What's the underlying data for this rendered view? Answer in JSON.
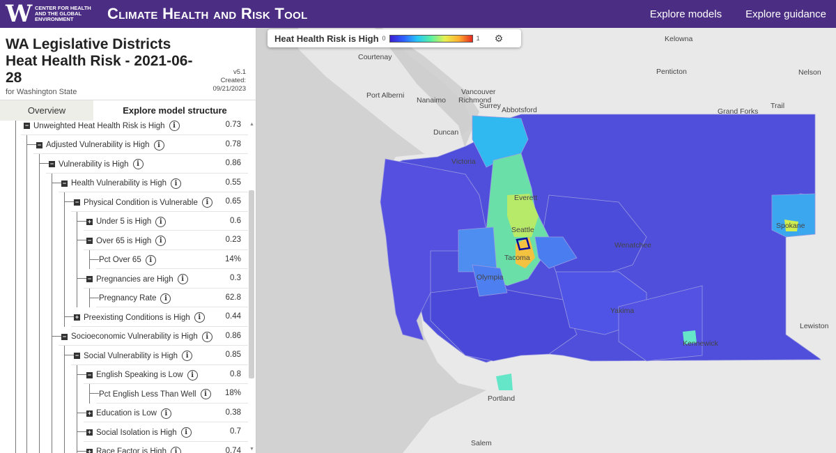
{
  "header": {
    "logo_mark": "W",
    "logo_text": "Center for Health and the Global Environment",
    "app_title": "Climate Health and Risk Tool",
    "nav": [
      "Explore models",
      "Explore guidance"
    ]
  },
  "sidebar": {
    "title": "WA Legislative Districts Heat Health Risk - 2021-06-28",
    "subtitle": "for Washington State",
    "version": "v5.1",
    "created_label": "Created:",
    "created_date": "09/21/2023",
    "tabs": [
      {
        "label": "Overview",
        "active": false
      },
      {
        "label": "Explore model structure",
        "active": true
      }
    ],
    "tree": [
      {
        "label": "Unweighted Heat Health Risk is High",
        "value": "0.73",
        "level": 0,
        "toggle": "minus"
      },
      {
        "label": "Adjusted Vulnerability is High",
        "value": "0.78",
        "level": 1,
        "toggle": "minus"
      },
      {
        "label": "Vulnerability is High",
        "value": "0.86",
        "level": 2,
        "toggle": "minus"
      },
      {
        "label": "Health Vulnerability is High",
        "value": "0.55",
        "level": 3,
        "toggle": "minus"
      },
      {
        "label": "Physical Condition is Vulnerable",
        "value": "0.65",
        "level": 4,
        "toggle": "minus"
      },
      {
        "label": "Under 5 is High",
        "value": "0.6",
        "level": 5,
        "toggle": "plus"
      },
      {
        "label": "Over 65 is High",
        "value": "0.23",
        "level": 5,
        "toggle": "minus"
      },
      {
        "label": "Pct Over 65",
        "value": "14%",
        "level": 6,
        "toggle": "none"
      },
      {
        "label": "Pregnancies are High",
        "value": "0.3",
        "level": 5,
        "toggle": "minus"
      },
      {
        "label": "Pregnancy Rate",
        "value": "62.8",
        "level": 6,
        "toggle": "none"
      },
      {
        "label": "Preexisting Conditions is High",
        "value": "0.44",
        "level": 4,
        "toggle": "plus"
      },
      {
        "label": "Socioeconomic Vulnerability is High",
        "value": "0.86",
        "level": 3,
        "toggle": "minus"
      },
      {
        "label": "Social Vulnerability is High",
        "value": "0.85",
        "level": 4,
        "toggle": "minus"
      },
      {
        "label": "English Speaking is Low",
        "value": "0.8",
        "level": 5,
        "toggle": "minus"
      },
      {
        "label": "Pct English Less Than Well",
        "value": "18%",
        "level": 6,
        "toggle": "none"
      },
      {
        "label": "Education is Low",
        "value": "0.38",
        "level": 5,
        "toggle": "plus"
      },
      {
        "label": "Social Isolation is High",
        "value": "0.7",
        "level": 5,
        "toggle": "plus"
      },
      {
        "label": "Race Factor is High",
        "value": "0.74",
        "level": 5,
        "toggle": "plus"
      }
    ]
  },
  "map": {
    "legend": {
      "title": "Heat Health Risk is High",
      "min": "0",
      "max": "1",
      "settings_icon": "gear-icon"
    },
    "cities": [
      "Kelowna",
      "Courtenay",
      "Penticton",
      "Nelson",
      "Port Alberni",
      "Nanaimo",
      "Vancouver",
      "Richmond",
      "Surrey",
      "Abbotsford",
      "Grand Forks",
      "Trail",
      "Duncan",
      "Victoria",
      "Everett",
      "Seattle",
      "Wenatchee",
      "Spokane",
      "Tacoma",
      "Olympia",
      "Yakima",
      "Kennewick",
      "Lewiston",
      "Portland",
      "Salem"
    ]
  }
}
